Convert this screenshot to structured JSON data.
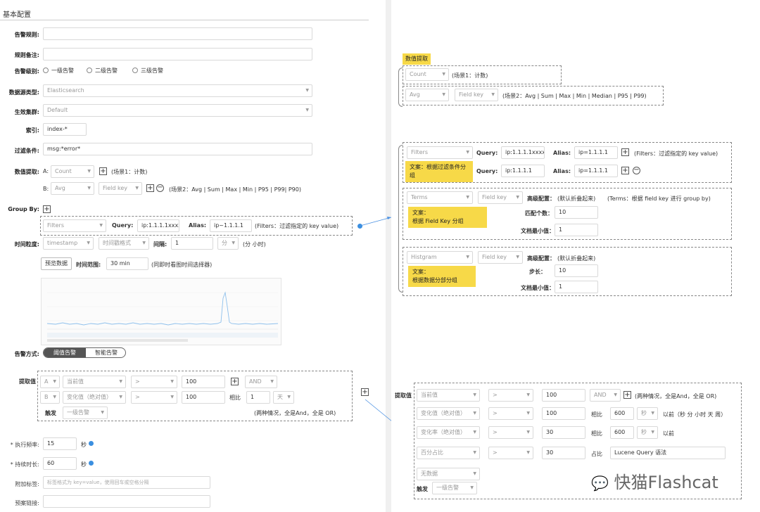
{
  "left": {
    "section_title": "基本配置",
    "alert_rule_label": "告警规则:",
    "rule_note_label": "规则备注:",
    "level_label": "告警级别:",
    "level_options": [
      "一级告警",
      "二级告警",
      "三级告警"
    ],
    "datasource_type_label": "数据源类型:",
    "datasource_type_value": "Elasticsearch",
    "cluster_label": "生效集群:",
    "cluster_value": "Default",
    "index_label": "索引:",
    "index_value": "index-*",
    "filter_label": "过滤条件:",
    "filter_value": "msg:*error*",
    "extract_label": "数值提取:",
    "row_a_prefix": "A:",
    "row_a_select": "Count",
    "row_a_note": "(场景1：计数)",
    "row_b_prefix": "B:",
    "row_b_select": "Avg",
    "row_b_field": "Field key",
    "row_b_note": "(场景2：Avg | Sum | Max | Min | P95 | P99| P90)",
    "groupby_label": "Group By:",
    "gb_filters": "Filters",
    "gb_query_label": "Query:",
    "gb_query_value": "ip:1.1.1.1xxxx",
    "gb_alias_label": "Alias:",
    "gb_alias_value": "ip~1.1.1.1",
    "gb_note": "(Filters：过滤指定的 key value)",
    "time_label": "时间粒度:",
    "time_field": "timestamp",
    "time_format": "时间戳格式",
    "interval_label": "间隔:",
    "interval_value": "1",
    "interval_unit": "分",
    "interval_note": "(分 小时)",
    "preview_btn": "预览数据",
    "range_label": "时间范围:",
    "range_value": "30 min",
    "range_note": "(同即时看图时间选择器)",
    "alert_mode_label": "告警方式:",
    "mode_threshold": "阈值告警",
    "mode_smart": "智能告警",
    "cond_label": "提取值",
    "cond_rows": [
      {
        "var": "A",
        "metric": "当前值",
        "op": ">",
        "value": "100",
        "logic": "AND"
      },
      {
        "var": "B",
        "metric": "变化值（绝对值）",
        "op": ">",
        "value": "100",
        "cmp_label": "相比",
        "cmp_value": "1",
        "cmp_unit": "天"
      }
    ],
    "trigger_label": "触发",
    "trigger_value": "一级告警",
    "trigger_note": "(两种情况，全是And，全是 OR)",
    "exec_freq_label": "* 执行频率:",
    "exec_freq_value": "15",
    "exec_freq_unit": "秒",
    "duration_label": "* 持续时长:",
    "duration_value": "60",
    "duration_unit": "秒",
    "extra_tags_label": "附加标签:",
    "extra_tags_placeholder": "标签格式为 key=value，使用回车或空格分隔",
    "plan_link_label": "预案链接:"
  },
  "right": {
    "extract_title": "数值提取",
    "count_select": "Count",
    "count_note": "(场景1：计数)",
    "avg_select": "Avg",
    "avg_field": "Field key",
    "avg_note": "(场景2：Avg | Sum | Max | Min | Median | P95 | P99)",
    "filters_select": "Filters",
    "q_label": "Query:",
    "q1_value": "ip:1.1.1.1xxxx",
    "alias_label": "Alias:",
    "alias1_value": "ip=1.1.1.1",
    "filters_note": "(Filters：过滤指定的 key value)",
    "filters_copy": "文案：根据过滤条件分组",
    "q2_value": "ip:1.1.1.1",
    "alias2_value": "ip=1.1.1.1",
    "terms_select": "Terms",
    "terms_field": "Field key",
    "adv_label": "高级配置：",
    "adv_note": "(默认折叠起来)",
    "terms_note": "(Terms：根据 field key 进行 group by)",
    "terms_copy": "文案：\n根据 Field Key 分组",
    "match_count_label": "匹配个数：",
    "match_count_value": "10",
    "min_doc_label": "文档最小值：",
    "min_doc_value": "1",
    "hist_select": "Histgram",
    "hist_field": "Field key",
    "hist_copy": "文案：\n根据数据分部分组",
    "step_label": "步长：",
    "step_value": "10",
    "hist_min_doc_value": "1",
    "cond_label": "提取值",
    "cond_rows": [
      {
        "metric": "当前值",
        "op": ">",
        "value": "100",
        "logic": "AND",
        "note": "(两种情况，全是And，全是 OR)"
      },
      {
        "metric": "变化值（绝对值）",
        "op": ">",
        "value": "100",
        "cmp": "相比",
        "cmp_value": "600",
        "unit": "秒",
        "suffix": "以前（秒 分 小时 天 周）"
      },
      {
        "metric": "变化率（绝对值）",
        "op": ">",
        "value": "30",
        "cmp": "相比",
        "cmp_value": "600",
        "unit": "秒",
        "suffix": "以前"
      },
      {
        "metric": "百分占比",
        "op": ">",
        "value": "30",
        "cmp": "占比",
        "cmp_value": "Lucene Query 语法"
      }
    ],
    "nodata": "无数据",
    "trigger_label": "触发",
    "trigger_value": "一级告警",
    "watermark": "快猫Flashcat"
  }
}
